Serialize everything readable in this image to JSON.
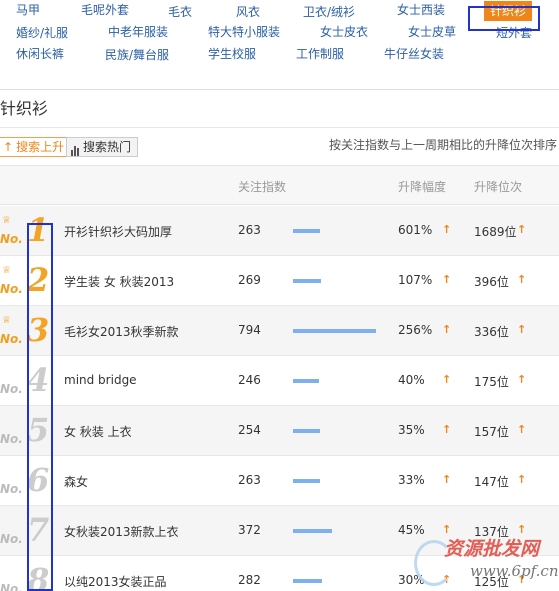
{
  "categories": [
    {
      "label": "马甲",
      "active": false
    },
    {
      "label": "毛呢外套",
      "active": false
    },
    {
      "label": "毛衣",
      "active": false
    },
    {
      "label": "风衣",
      "active": false
    },
    {
      "label": "卫衣/绒衫",
      "active": false
    },
    {
      "label": "女士西装",
      "active": false
    },
    {
      "label": "针织衫",
      "active": true
    },
    {
      "label": "婚纱/礼服",
      "active": false
    },
    {
      "label": "中老年服装",
      "active": false
    },
    {
      "label": "特大特小服装",
      "active": false
    },
    {
      "label": "女士皮衣",
      "active": false
    },
    {
      "label": "女士皮草",
      "active": false
    },
    {
      "label": "短外套",
      "active": false
    },
    {
      "label": "休闲长裤",
      "active": false
    },
    {
      "label": "民族/舞台服",
      "active": false
    },
    {
      "label": "学生校服",
      "active": false
    },
    {
      "label": "工作制服",
      "active": false
    },
    {
      "label": "牛仔丝女装",
      "active": false
    }
  ],
  "section_title": "针织衫",
  "tabs": {
    "search_up": "搜索上升",
    "search_hot": "搜索热门"
  },
  "note": "按关注指数与上一周期相比的升降位次排序",
  "table": {
    "headers": {
      "index": "关注指数",
      "change": "升降幅度",
      "position": "升降位次"
    },
    "no_label": "No.",
    "rows": [
      {
        "rank": "1",
        "keyword": "开衫针织衫大码加厚",
        "index": 263,
        "change": "601%",
        "position": "1689位"
      },
      {
        "rank": "2",
        "keyword": "学生装 女 秋装2013",
        "index": 269,
        "change": "107%",
        "position": "396位"
      },
      {
        "rank": "3",
        "keyword": "毛衫女2013秋季新款",
        "index": 794,
        "change": "256%",
        "position": "336位"
      },
      {
        "rank": "4",
        "keyword": "mind bridge",
        "index": 246,
        "change": "40%",
        "position": "175位"
      },
      {
        "rank": "5",
        "keyword": "女 秋装 上衣",
        "index": 254,
        "change": "35%",
        "position": "157位"
      },
      {
        "rank": "6",
        "keyword": "森女",
        "index": 263,
        "change": "33%",
        "position": "147位"
      },
      {
        "rank": "7",
        "keyword": "女秋装2013新款上衣",
        "index": 372,
        "change": "45%",
        "position": "137位"
      },
      {
        "rank": "8",
        "keyword": "以纯2013女装正品",
        "index": 282,
        "change": "30%",
        "position": "125位"
      }
    ]
  },
  "watermark": {
    "line1": "资源批发网",
    "line2": "www.6pf.cn"
  },
  "colors": {
    "accent": "#f08519",
    "link": "#2a5fa8",
    "bar": "#7fb0ee",
    "highlight_box": "#2233cc"
  }
}
